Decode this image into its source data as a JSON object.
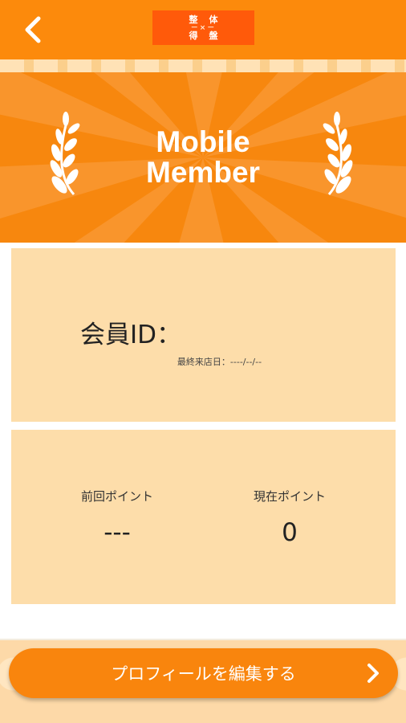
{
  "header": {
    "back_icon": "chevron-left-icon",
    "logo": {
      "top": "整体",
      "middle": "－×－",
      "bottom": "得盤"
    }
  },
  "banner": {
    "title_line1": "Mobile",
    "title_line2": "Member",
    "left_icon": "laurel-left-icon",
    "right_icon": "laurel-right-icon"
  },
  "member_card": {
    "id_label": "会員ID：",
    "last_visit_label": "最終来店日：----/--/--"
  },
  "points_card": {
    "previous_label": "前回ポイント",
    "previous_value": "---",
    "current_label": "現在ポイント",
    "current_value": "0"
  },
  "edit_profile": {
    "label": "プロフィールを編集する",
    "icon": "chevron-right-icon"
  },
  "colors": {
    "accent": "#fc8a0c",
    "card": "#fdddaa",
    "logo_bg": "#ff5a0a"
  }
}
